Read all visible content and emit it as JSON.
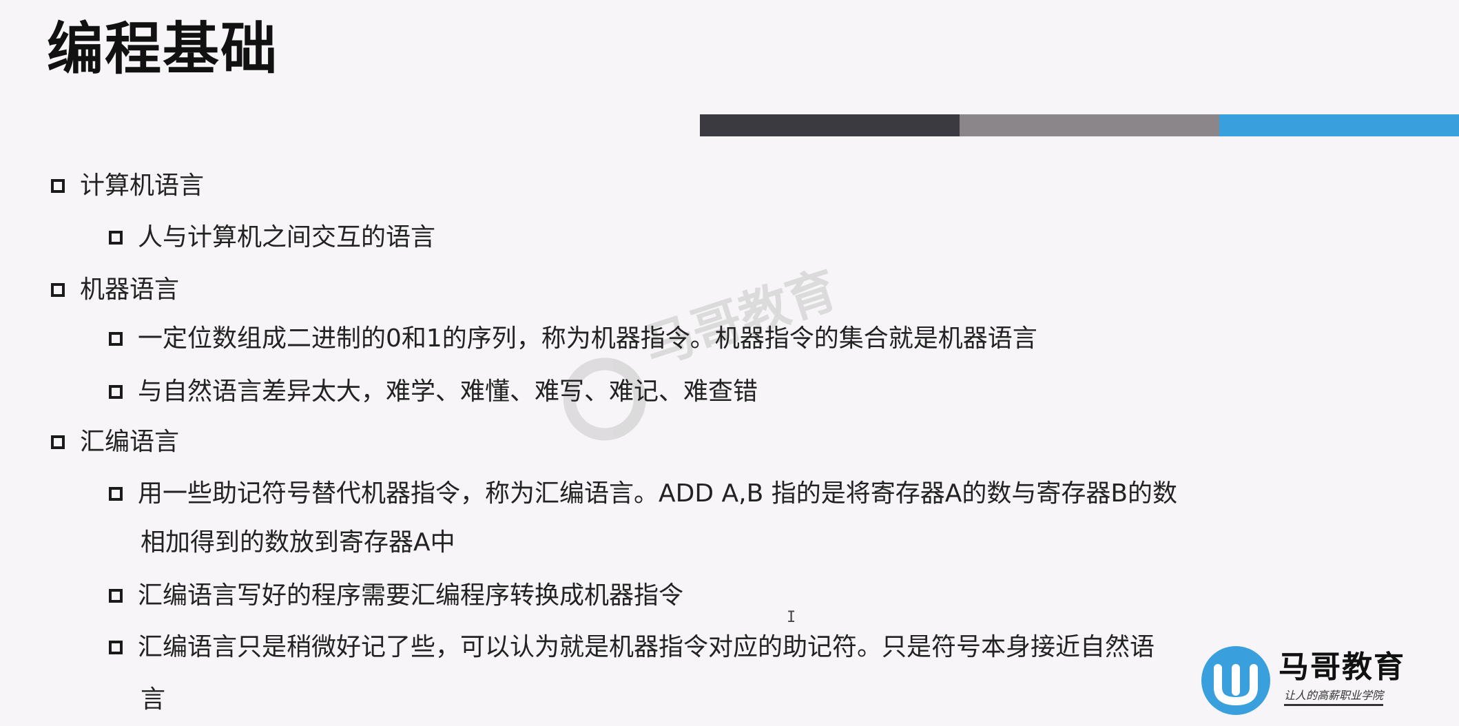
{
  "slide": {
    "title": "编程基础",
    "accent_colors": {
      "dark": "#3b3a40",
      "gray": "#8a8689",
      "blue": "#3aa0dd"
    },
    "items": [
      {
        "level": 1,
        "text": "计算机语言"
      },
      {
        "level": 2,
        "text": "人与计算机之间交互的语言"
      },
      {
        "level": 1,
        "text": "机器语言"
      },
      {
        "level": 2,
        "text": "一定位数组成二进制的0和1的序列，称为机器指令。机器指令的集合就是机器语言"
      },
      {
        "level": 2,
        "text": "与自然语言差异太大，难学、难懂、难写、难记、难查错"
      },
      {
        "level": 1,
        "text": "汇编语言"
      },
      {
        "level": 2,
        "text": "用一些助记符号替代机器指令，称为汇编语言。ADD A,B 指的是将寄存器A的数与寄存器B的数",
        "continuation": "相加得到的数放到寄存器A中"
      },
      {
        "level": 2,
        "text": "汇编语言写好的程序需要汇编程序转换成机器指令"
      },
      {
        "level": 2,
        "text": "汇编语言只是稍微好记了些，可以认为就是机器指令对应的助记符。只是符号本身接近自然语",
        "continuation": "言"
      }
    ]
  },
  "watermark": {
    "text": "马哥教育",
    "icon": "mage-logo-icon"
  },
  "cursor": {
    "glyph": "I"
  },
  "logo": {
    "name": "马哥教育",
    "tagline": "让人的高薪职业学院",
    "icon": "mage-logo-icon",
    "color": "#3aa0dd"
  }
}
